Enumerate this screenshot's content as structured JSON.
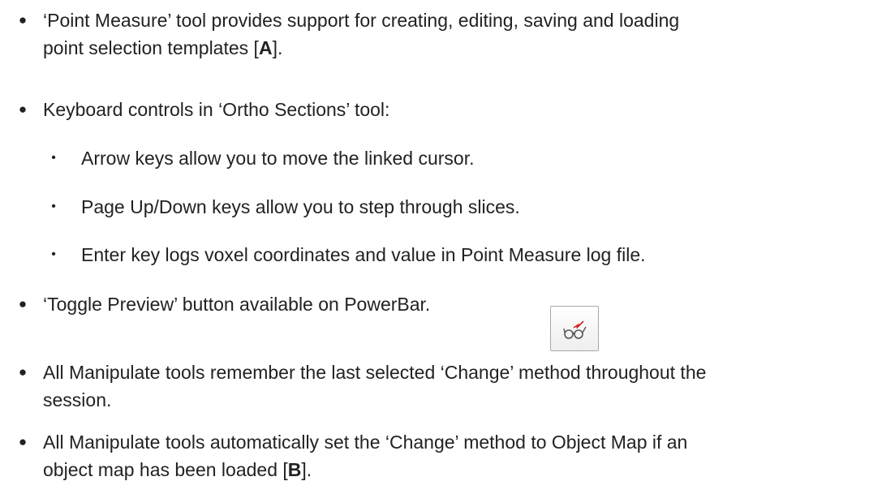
{
  "items": [
    {
      "line1": "‘Point Measure’ tool provides support for creating, editing, saving and loading",
      "line2_prefix": "point selection templates [",
      "line2_bold": "A",
      "line2_suffix": "]."
    },
    {
      "line1": "Keyboard controls in ‘Ortho Sections’ tool:"
    },
    {
      "line1": "Arrow keys allow you to move the linked cursor."
    },
    {
      "line1": "Page Up/Down keys allow you to step through slices."
    },
    {
      "line1": "Enter key logs voxel coordinates and value in Point Measure log file."
    },
    {
      "line1": "‘Toggle Preview’ button available on PowerBar."
    },
    {
      "line1": "All Manipulate tools remember the last selected ‘Change’ method throughout the",
      "line2": "session."
    },
    {
      "line1": "All Manipulate tools automatically set the ‘Change’ method to Object Map if an",
      "line2_prefix": "object map has been loaded [",
      "line2_bold": "B",
      "line2_suffix": "]."
    }
  ],
  "bullets": {
    "main": "●",
    "sub": "•"
  },
  "icons": {
    "toggle_preview": "glasses-icon",
    "accent": "#d32020",
    "stroke": "#555555"
  }
}
